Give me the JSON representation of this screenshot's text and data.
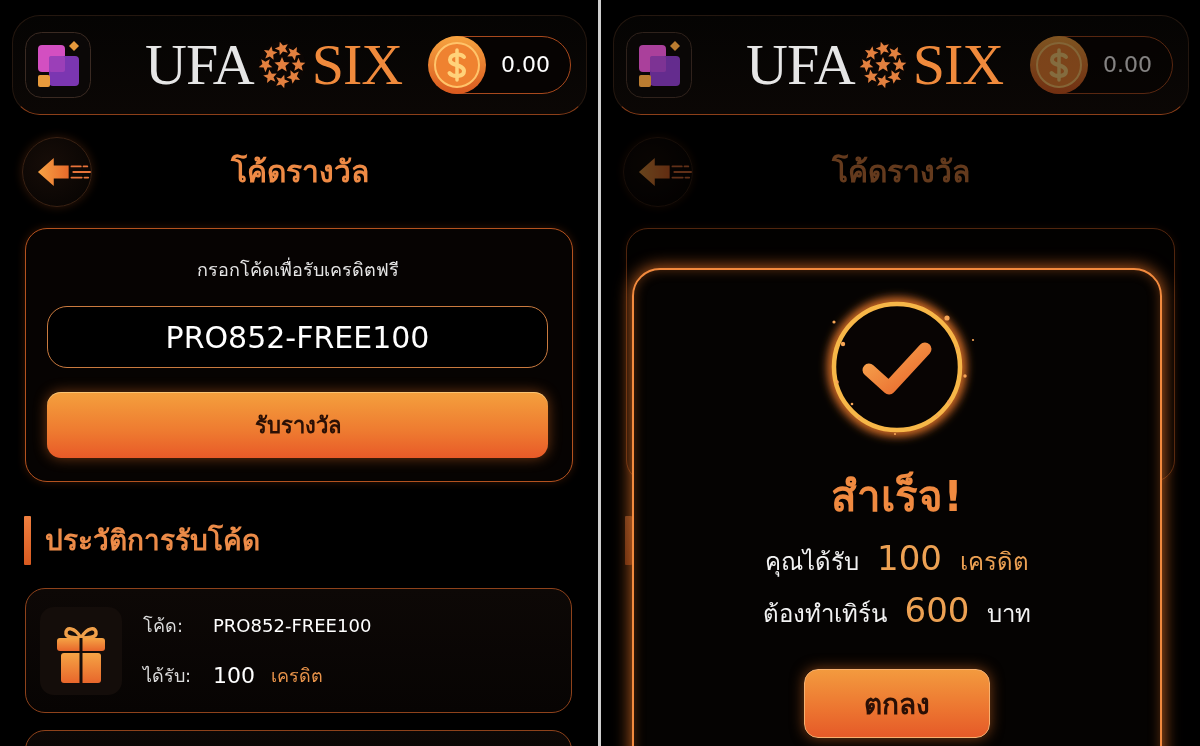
{
  "screens": [
    {
      "header": {
        "logo": [
          "UFA",
          "SIX"
        ],
        "balance": "0.00"
      },
      "page_title": "โค้ดรางวัล",
      "redeem": {
        "label": "กรอกโค้ดเพื่อรับเครดิตฟรี",
        "code": "PRO852-FREE100",
        "button": "รับรางวัล"
      },
      "history": {
        "title": "ประวัติการรับโค้ด",
        "items": [
          {
            "code_label": "โค้ด:",
            "code": "PRO852-FREE100",
            "received_label": "ได้รับ:",
            "amount": "100",
            "unit": "เครดิต"
          }
        ]
      }
    },
    {
      "header": {
        "logo": [
          "UFA",
          "SIX"
        ],
        "balance": "0.00"
      },
      "page_title": "โค้ดรางวัล",
      "dialog": {
        "title": "สำเร็จ!",
        "lines": [
          {
            "label": "คุณได้รับ",
            "value": "100",
            "unit": "เครดิต",
            "highlighted": true
          },
          {
            "label": "ต้องทำเทิร์น",
            "value": "600",
            "unit": "บาท",
            "highlighted": false
          }
        ],
        "button": "ตกลง"
      }
    }
  ]
}
